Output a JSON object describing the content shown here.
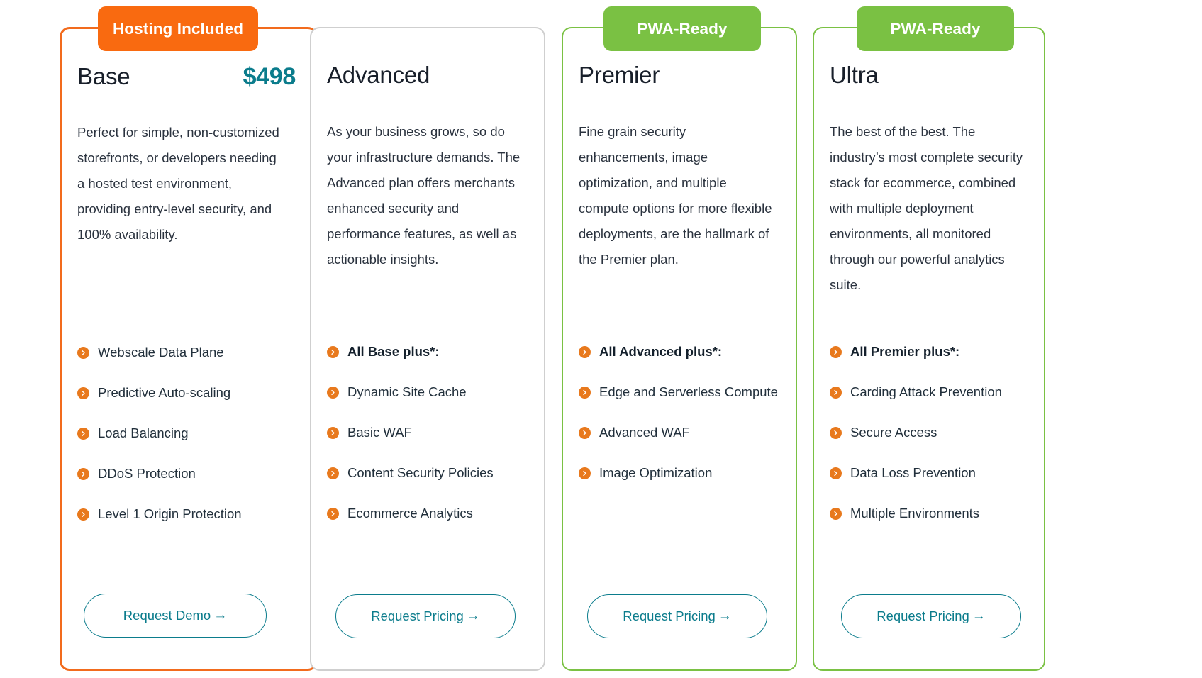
{
  "plans": [
    {
      "id": "base",
      "name": "Base",
      "price": "$498",
      "badge": {
        "label": "Hosting Included",
        "color": "#f96a10"
      },
      "border_color": "#f26b1d",
      "description": "Perfect for simple, non-customized storefronts, or developers needing a hosted test environment, providing entry-level security, and 100% availability.",
      "features": [
        {
          "label": "Webscale Data Plane",
          "bold": false
        },
        {
          "label": "Predictive Auto-scaling",
          "bold": false
        },
        {
          "label": "Load Balancing",
          "bold": false
        },
        {
          "label": "DDoS Protection",
          "bold": false
        },
        {
          "label": "Level 1 Origin Protection",
          "bold": false
        }
      ],
      "cta": "Request Demo"
    },
    {
      "id": "advanced",
      "name": "Advanced",
      "price": "",
      "badge": null,
      "border_color": "#cfcfcf",
      "description": "As your business grows, so do your infrastructure demands. The Advanced plan offers merchants enhanced security and performance features, as well as actionable insights.",
      "features": [
        {
          "label": "All Base plus*:",
          "bold": true
        },
        {
          "label": "Dynamic Site Cache",
          "bold": false
        },
        {
          "label": "Basic WAF",
          "bold": false
        },
        {
          "label": "Content Security Policies",
          "bold": false
        },
        {
          "label": "Ecommerce Analytics",
          "bold": false
        }
      ],
      "cta": "Request Pricing"
    },
    {
      "id": "premier",
      "name": "Premier",
      "price": "",
      "badge": {
        "label": "PWA-Ready",
        "color": "#7ac143"
      },
      "border_color": "#7ac143",
      "description": "Fine grain security enhancements, image optimization, and multiple compute options for more flexible deployments, are the hallmark of the Premier plan.",
      "features": [
        {
          "label": "All Advanced plus*:",
          "bold": true
        },
        {
          "label": "Edge and Serverless Compute",
          "bold": false
        },
        {
          "label": "Advanced WAF",
          "bold": false
        },
        {
          "label": "Image Optimization",
          "bold": false
        }
      ],
      "cta": "Request Pricing"
    },
    {
      "id": "ultra",
      "name": "Ultra",
      "price": "",
      "badge": {
        "label": "PWA-Ready",
        "color": "#7ac143"
      },
      "border_color": "#7ac143",
      "description": "The best of the best. The industry’s most complete security stack for ecommerce, combined with multiple deployment environments, all monitored through our powerful analytics suite.",
      "features": [
        {
          "label": "All Premier plus*:",
          "bold": true
        },
        {
          "label": "Carding Attack Prevention",
          "bold": false
        },
        {
          "label": "Secure Access",
          "bold": false
        },
        {
          "label": "Data Loss Prevention",
          "bold": false
        },
        {
          "label": "Multiple Environments",
          "bold": false
        }
      ],
      "cta": "Request Pricing"
    }
  ],
  "theme": {
    "accent_orange": "#f26b1d",
    "accent_green": "#7ac143",
    "accent_teal": "#0b7c8c",
    "bullet_orange": "#e8791d",
    "text_dark": "#22303c"
  },
  "icons": {
    "feature_bullet": "chevron-right-circle-icon",
    "cta_arrow": "arrow-right-icon"
  },
  "cta_arrow_glyph": "→"
}
